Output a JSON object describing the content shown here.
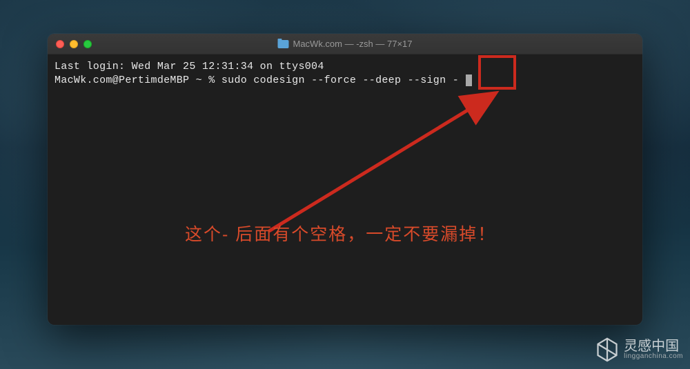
{
  "window": {
    "title": "MacWk.com — -zsh — 77×17"
  },
  "terminal": {
    "line1": "Last login: Wed Mar 25 12:31:34 on ttys004",
    "prompt": "MacWk.com@PertimdeMBP ~ % ",
    "command": "sudo codesign --force --deep --sign - "
  },
  "annotation": {
    "text": "这个- 后面有个空格，一定不要漏掉！",
    "highlight_color": "#cc2a1e"
  },
  "watermark": {
    "main": "灵感中国",
    "sub": "lingganchina.com"
  }
}
